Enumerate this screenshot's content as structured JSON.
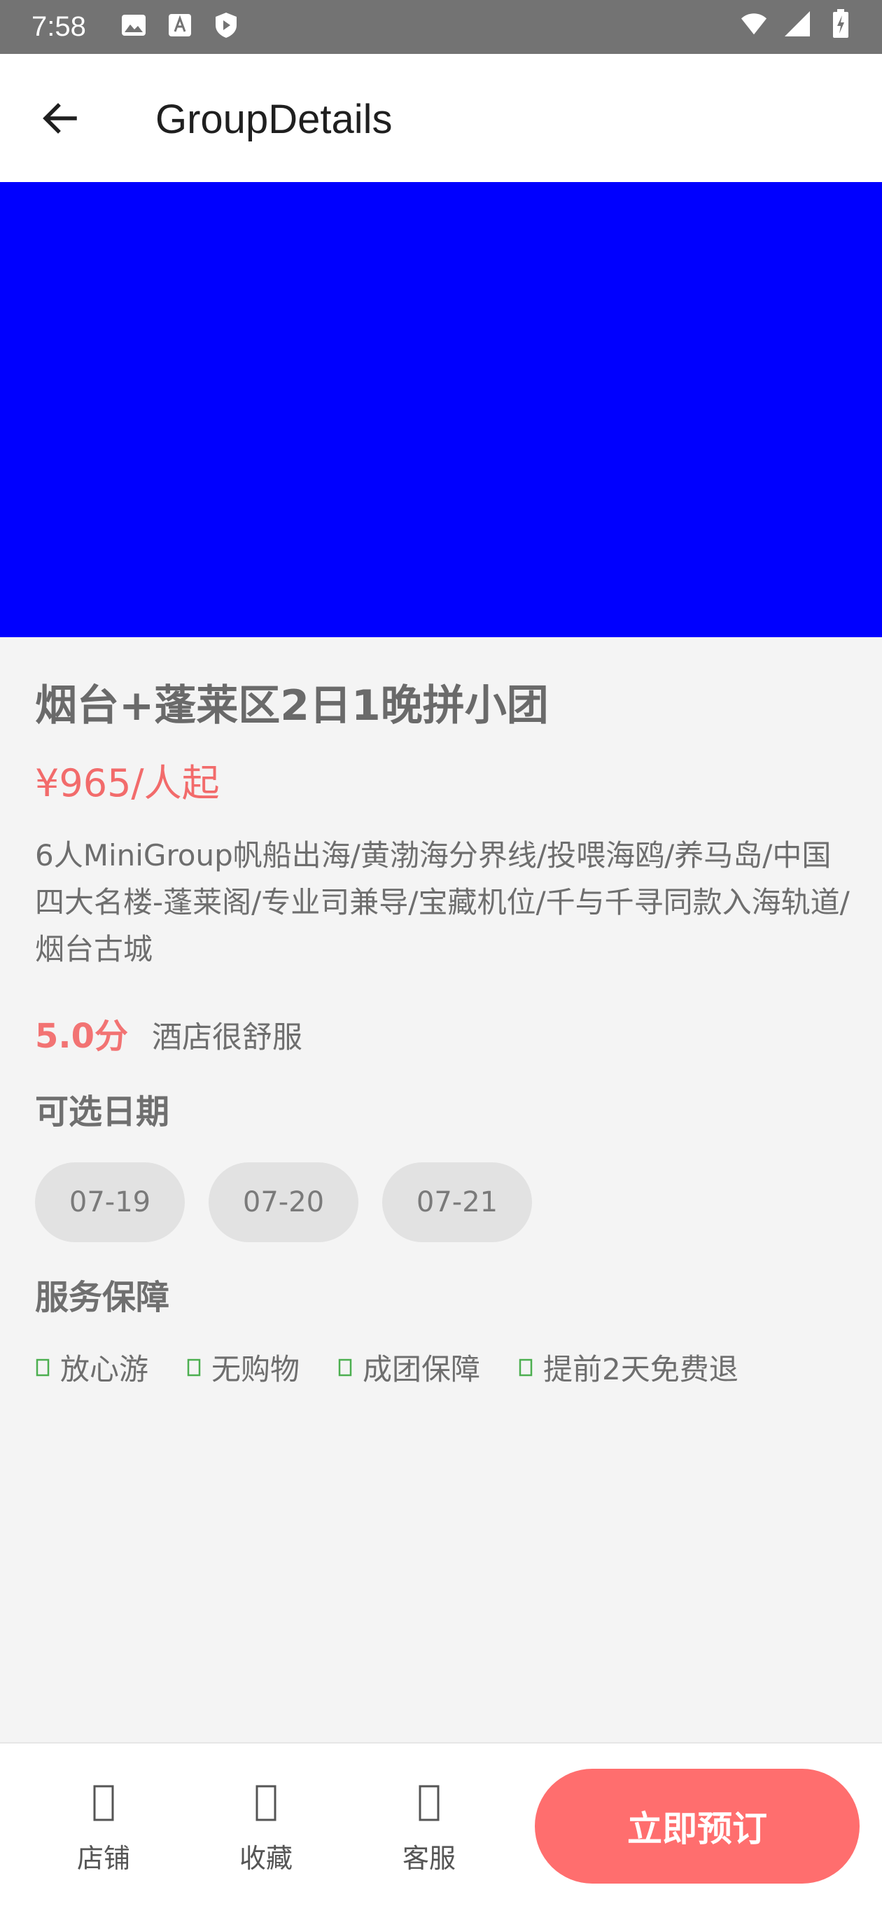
{
  "status_bar": {
    "time": "7:58",
    "icons_left": [
      "image-icon",
      "font-icon",
      "play-shield-icon"
    ],
    "icons_right": [
      "wifi-icon",
      "signal-icon",
      "battery-icon"
    ]
  },
  "app_bar": {
    "title": "GroupDetails",
    "back_icon": "arrow-left-icon"
  },
  "banner": {
    "color": "#0000ff"
  },
  "product": {
    "title": "烟台+蓬莱区2日1晚拼小团",
    "price": "¥965/人起",
    "description": "6人MiniGroup帆船出海/黄渤海分界线/投喂海鸥/养马岛/中国四大名楼-蓬莱阁/专业司兼导/宝藏机位/千与千寻同款入海轨道/烟台古城",
    "rating": "5.0分",
    "rating_comment": "酒店很舒服"
  },
  "dates": {
    "title": "可选日期",
    "options": [
      "07-19",
      "07-20",
      "07-21"
    ]
  },
  "service": {
    "title": "服务保障",
    "items": [
      "放心游",
      "无购物",
      "成团保障",
      "提前2天免费退"
    ],
    "check_color": "#4caf50"
  },
  "bottom_bar": {
    "shop_label": "店铺",
    "favorite_label": "收藏",
    "service_label": "客服",
    "book_label": "立即预订",
    "accent_color": "#ff6e6e"
  }
}
